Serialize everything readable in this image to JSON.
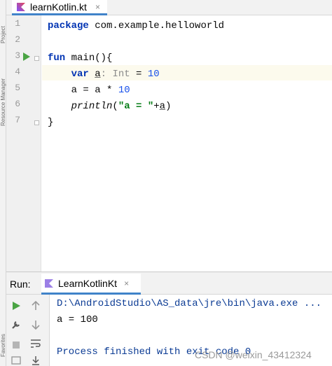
{
  "left_strip": {
    "top_text": "Project",
    "bottom_text": "Resource Manager",
    "lower_text": "Favorites"
  },
  "editor_tab": {
    "label": "learnKotlin.kt",
    "close": "×"
  },
  "line_numbers": [
    "1",
    "2",
    "3",
    "4",
    "5",
    "6",
    "7"
  ],
  "code": {
    "line1": {
      "kw": "package",
      "rest": " com.example.helloworld"
    },
    "line3": {
      "kw": "fun",
      "rest": " main(){"
    },
    "line4": {
      "indent": "    ",
      "kw": "var",
      "sp": " ",
      "var_name": "a",
      "hint": ": Int",
      "eq": " = ",
      "num": "10"
    },
    "line5": {
      "indent": "    ",
      "lhs": "a",
      "mid": " = ",
      "rhs": "a",
      "op": " * ",
      "num": "10"
    },
    "line6": {
      "indent": "    ",
      "fn": "println",
      "open": "(",
      "str": "\"a = \"",
      "plus": "+",
      "arg": "a",
      "close": ")"
    },
    "line7": {
      "text": "}"
    }
  },
  "run_panel": {
    "title": "Run:",
    "tab_label": "LearnKotlinKt",
    "tab_close": "×",
    "console": {
      "cmd": "D:\\AndroidStudio\\AS_data\\jre\\bin\\java.exe ...",
      "output": "a = 100",
      "finished": "Process finished with exit code 0"
    }
  },
  "watermark": "CSDN @weixin_43412324",
  "colors": {
    "accent": "#4083c9",
    "run_green": "#4aa444",
    "keyword": "#0033b3",
    "number": "#1750eb",
    "string": "#067d17"
  }
}
